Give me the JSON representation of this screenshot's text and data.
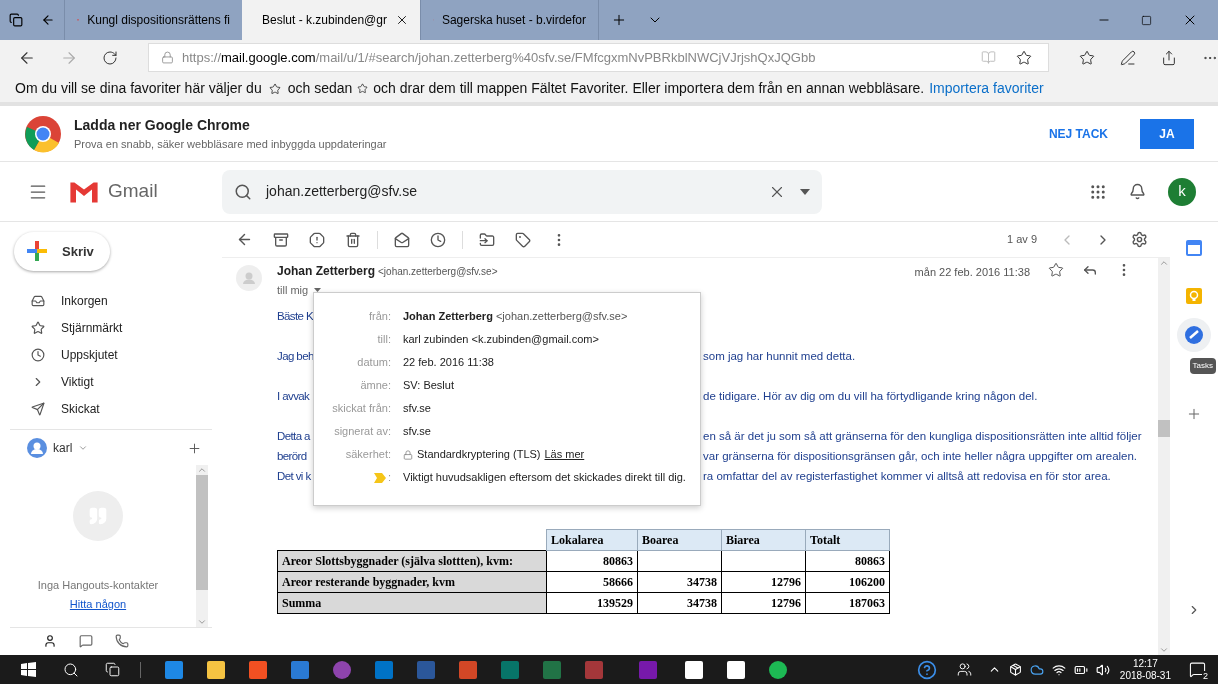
{
  "browser": {
    "tabs": [
      {
        "title": "Kungl dispositionsrättens fi",
        "selected": false
      },
      {
        "title": "Beslut - k.zubinden@gr",
        "selected": true
      },
      {
        "title": "Sagerska huset - b.virdefor",
        "selected": false
      }
    ],
    "url": {
      "prefix": "https://",
      "host": "mail.google.com",
      "path": "/mail/u/1/#search/johan.zetterberg%40sfv.se/FMfcgxmNvPBRkblNWCjVJrjshQxJQGbb"
    },
    "favorites_bar": {
      "text_1": "Om du vill se dina favoriter här väljer du",
      "text_2": "och sedan",
      "text_3": "och drar dem till mappen Fältet Favoriter. Eller importera dem från en annan webbläsare.",
      "link": "Importera favoriter"
    }
  },
  "chrome_promo": {
    "title": "Ladda ner Google Chrome",
    "subtitle": "Prova en snabb, säker webbläsare med inbyggda uppdateringar",
    "buttons": [
      {
        "label": "NEJ TACK",
        "kind": "text"
      },
      {
        "label": "JA",
        "kind": "filled"
      }
    ]
  },
  "gmail": {
    "logo": "Gmail",
    "search": {
      "value": "johan.zetterberg@sfv.se"
    },
    "avatar": "k"
  },
  "sidebar": {
    "compose": "Skriv",
    "items": [
      {
        "label": "Inkorgen",
        "kind": "inbox"
      },
      {
        "label": "Stjärnmärkt",
        "kind": "starred"
      },
      {
        "label": "Uppskjutet",
        "kind": "snoozed"
      },
      {
        "label": "Viktigt",
        "kind": "important"
      },
      {
        "label": "Skickat",
        "kind": "sent"
      }
    ],
    "account": "karl",
    "hangouts": {
      "empty": "Inga Hangouts-kontakter",
      "link": "Hitta någon"
    }
  },
  "toolbar": {
    "counter": "1 av 9"
  },
  "message": {
    "sender": "Johan Zetterberg",
    "sender_email": "<johan.zetterberg@sfv.se>",
    "to": "till mig",
    "date": "mån 22 feb. 2016 11:38",
    "starred": false,
    "paragraphs": [
      {
        "lines": [
          {
            "left": "Bäste K"
          }
        ]
      },
      {
        "lines": [
          {
            "left": "Jag beh",
            "right": "som jag har hunnit med detta."
          }
        ]
      },
      {
        "lines": [
          {
            "left": "I avvak",
            "right": "de tidigare. Hör av dig om du vill ha förtydligande kring någon del."
          }
        ]
      },
      {
        "lines": [
          {
            "left": "Detta a",
            "right": "en så är det ju som så att gränserna för den kungliga dispositionsrätten inte alltid följer"
          },
          {
            "left": "berörd",
            "right": "var gränserna för dispositionsgränsen går, och inte heller några uppgifter om arealen."
          },
          {
            "left": "Det vi k",
            "right": "ra omfattar del av registerfastighet kommer vi alltså att redovisa en för stor area."
          }
        ]
      }
    ],
    "table": {
      "columns": [
        "Lokalarea",
        "Boarea",
        "Biarea",
        "Totalt"
      ],
      "rows": [
        {
          "label": "Areor Slottsbyggnader (själva slottten), kvm:",
          "cells": [
            "80863",
            null,
            null,
            "80863"
          ]
        },
        {
          "label": "Areor resterande byggnader, kvm",
          "cells": [
            "58666",
            "34738",
            "12796",
            "106200"
          ]
        },
        {
          "label": "Summa",
          "cells": [
            "139529",
            "34738",
            "12796",
            "187063"
          ]
        }
      ]
    }
  },
  "details": [
    {
      "kind": "sender",
      "label": "från:",
      "value": "Johan Zetterberg",
      "extra": "<johan.zetterberg@sfv.se>"
    },
    {
      "kind": "plain",
      "label": "till:",
      "value": "karl zubinden <k.zubinden@gmail.com>"
    },
    {
      "kind": "plain",
      "label": "datum:",
      "value": "22 feb. 2016 11:38"
    },
    {
      "kind": "plain",
      "label": "ämne:",
      "value": "SV: Beslut"
    },
    {
      "kind": "plain",
      "label": "skickat från:",
      "value": "sfv.se"
    },
    {
      "kind": "plain",
      "label": "signerat av:",
      "value": "sfv.se"
    },
    {
      "kind": "security",
      "label": "säkerhet:",
      "value": "Standardkryptering (TLS)",
      "link": "Läs mer"
    },
    {
      "kind": "importance",
      "label": ":",
      "value": "Viktigt huvudsakligen eftersom det skickades direkt till dig."
    }
  ],
  "right_rail": {
    "tooltip": "Tasks"
  },
  "taskbar": {
    "time": "12:17",
    "date": "2018-08-31",
    "notifications": "2"
  }
}
